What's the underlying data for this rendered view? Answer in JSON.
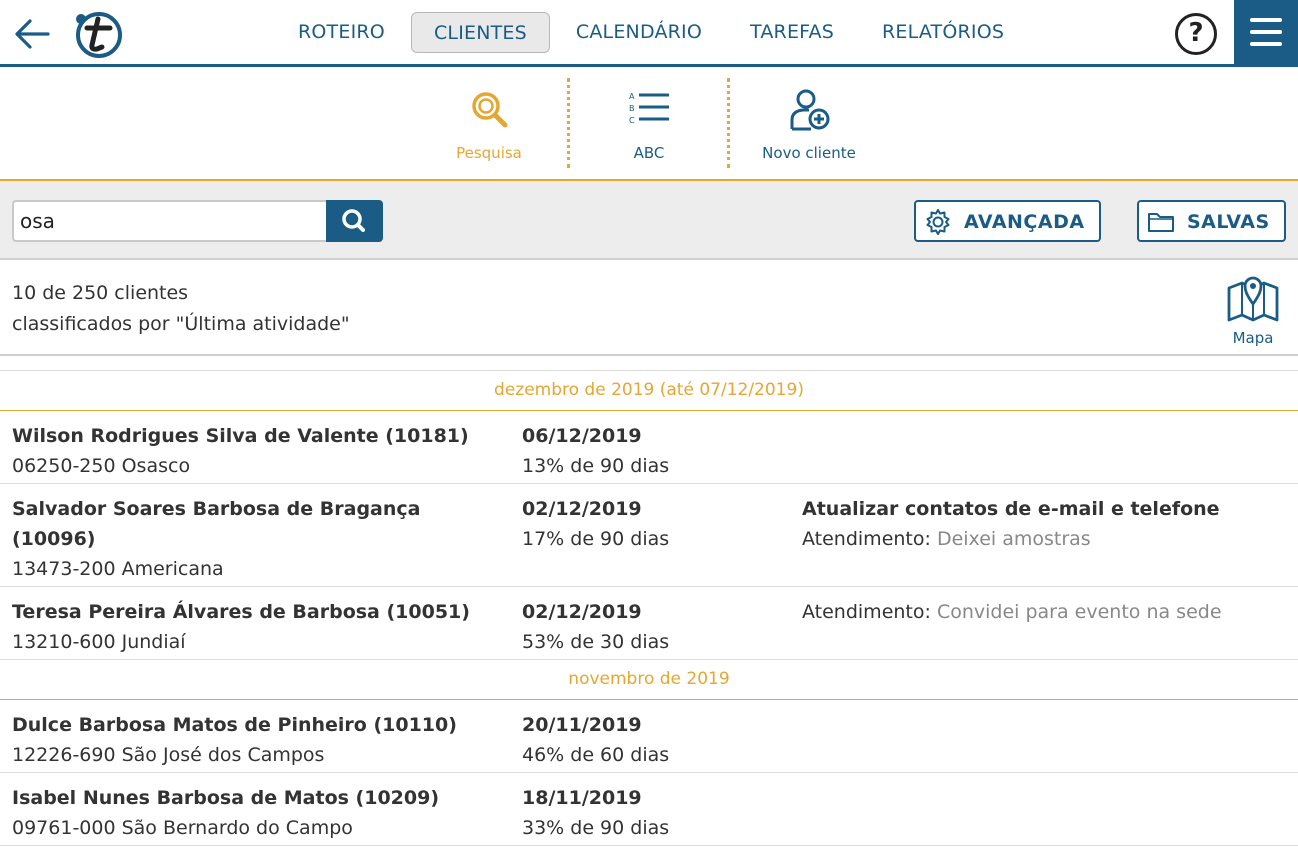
{
  "colors": {
    "brand": "#1b5c86",
    "accent": "#e5a731"
  },
  "header": {
    "nav": [
      {
        "label": "ROTEIRO",
        "active": false
      },
      {
        "label": "CLIENTES",
        "active": true
      },
      {
        "label": "CALENDÁRIO",
        "active": false
      },
      {
        "label": "TAREFAS",
        "active": false
      },
      {
        "label": "RELATÓRIOS",
        "active": false
      }
    ],
    "help_label": "?",
    "icons": {
      "back": "arrow-left-icon",
      "logo": "t-logo",
      "menu": "hamburger-menu-icon"
    }
  },
  "toolbar": {
    "search": {
      "label": "Pesquisa",
      "icon": "magnifier-icon",
      "active": true
    },
    "abc": {
      "label": "ABC",
      "icon": "abc-list-icon",
      "letters": [
        "A",
        "B",
        "C"
      ]
    },
    "new_client": {
      "label": "Novo cliente",
      "icon": "add-user-icon"
    }
  },
  "search": {
    "value": "osa",
    "advanced_label": "AVANÇADA",
    "saved_label": "SALVAS"
  },
  "summary": {
    "count": "10 de 250 clientes",
    "sort": "classificados por \"Última atividade\"",
    "map_label": "Mapa"
  },
  "groups": [
    {
      "label": "dezembro de 2019 (até 07/12/2019)",
      "clients": [
        {
          "name": "Wilson Rodrigues Silva de Valente (10181)",
          "address": "06250-250 Osasco",
          "date": "06/12/2019",
          "progress": "13% de 90 dias",
          "task": "",
          "attendance_label": "",
          "attendance_value": ""
        },
        {
          "name": "Salvador Soares Barbosa de Bragança (10096)",
          "address": "13473-200 Americana",
          "date": "02/12/2019",
          "progress": "17% de 90 dias",
          "task": "Atualizar contatos de e-mail e telefone",
          "attendance_label": "Atendimento:",
          "attendance_value": "Deixei amostras"
        },
        {
          "name": "Teresa Pereira Álvares de Barbosa (10051)",
          "address": "13210-600 Jundiaí",
          "date": "02/12/2019",
          "progress": "53% de 30 dias",
          "task": "",
          "attendance_label": "Atendimento:",
          "attendance_value": "Convidei para evento na sede"
        }
      ]
    },
    {
      "label": "novembro de 2019",
      "clients": [
        {
          "name": "Dulce Barbosa Matos de Pinheiro (10110)",
          "address": "12226-690 São José dos Campos",
          "date": "20/11/2019",
          "progress": "46% de 60 dias",
          "task": "",
          "attendance_label": "",
          "attendance_value": ""
        },
        {
          "name": "Isabel Nunes Barbosa de Matos (10209)",
          "address": "09761-000 São Bernardo do Campo",
          "date": "18/11/2019",
          "progress": "33% de 90 dias",
          "task": "",
          "attendance_label": "",
          "attendance_value": ""
        }
      ]
    }
  ]
}
